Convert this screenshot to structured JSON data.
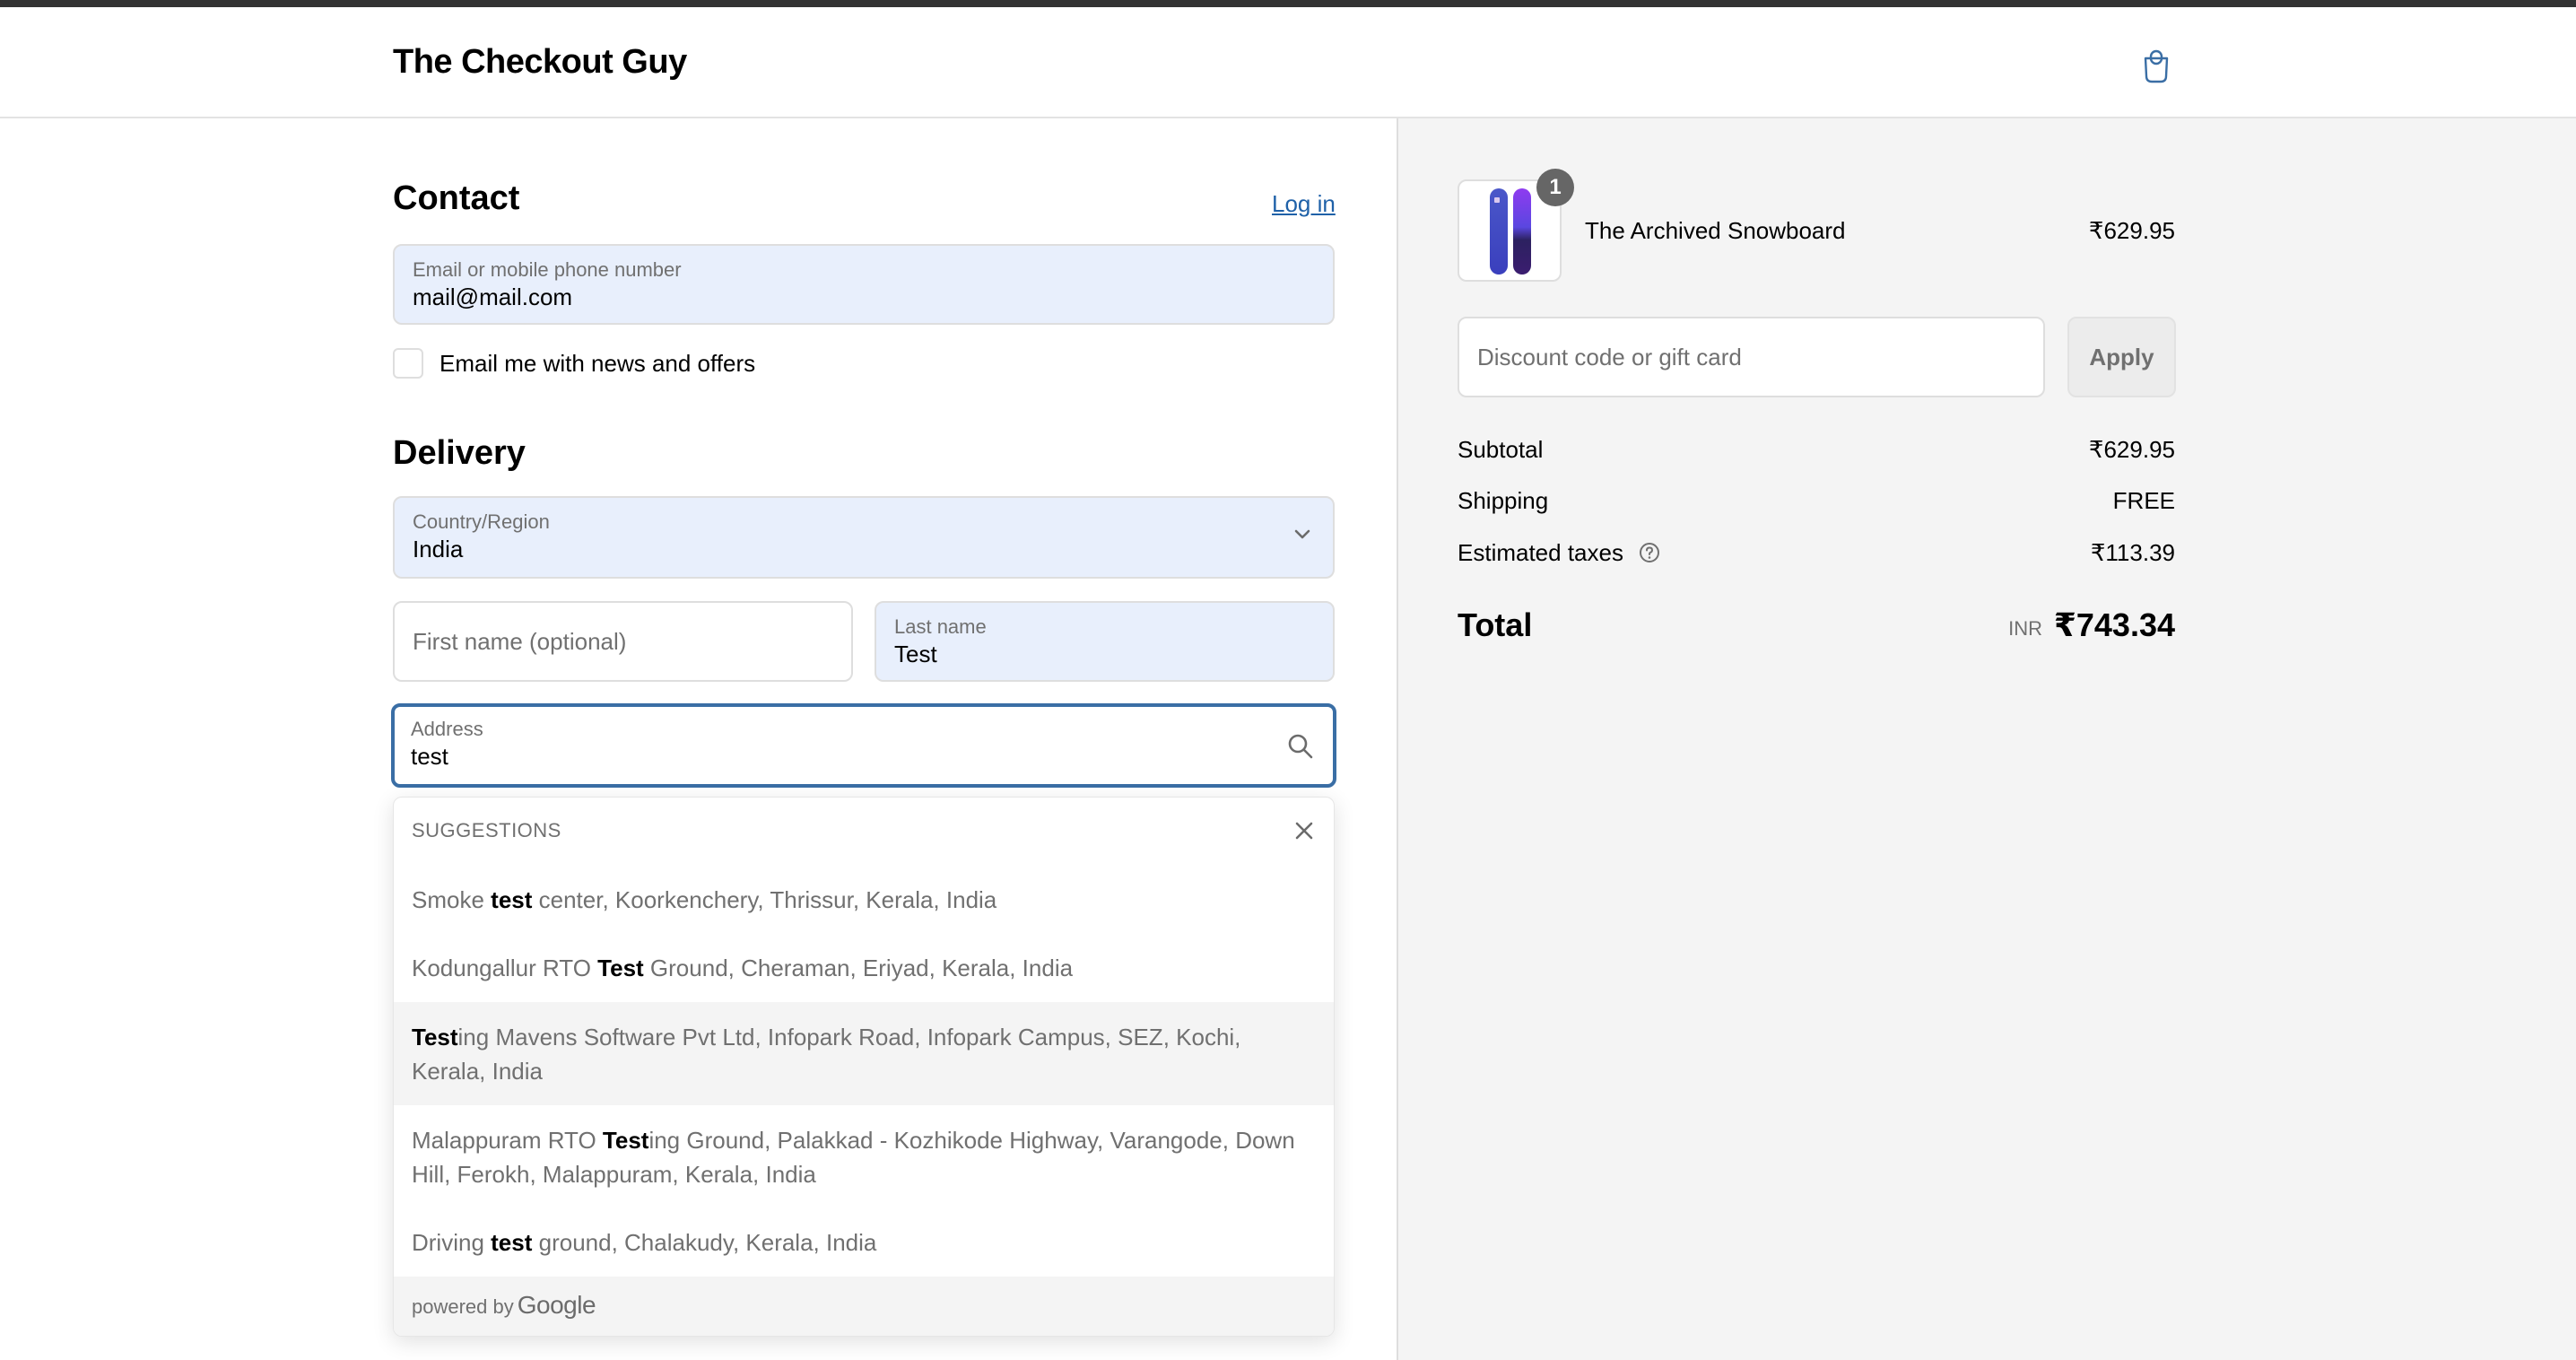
{
  "header": {
    "brand": "The Checkout Guy",
    "cart_icon": "shopping-bag-icon",
    "accent_color": "#3a6ea5"
  },
  "contact": {
    "title": "Contact",
    "login_link": "Log in",
    "email": {
      "label": "Email or mobile phone number",
      "value": "mail@mail.com"
    },
    "newsletter": {
      "label": "Email me with news and offers",
      "checked": false
    }
  },
  "delivery": {
    "title": "Delivery",
    "country": {
      "label": "Country/Region",
      "value": "India"
    },
    "first_name": {
      "placeholder": "First name (optional)",
      "value": ""
    },
    "last_name": {
      "label": "Last name",
      "value": "Test"
    },
    "address": {
      "label": "Address",
      "value": "test"
    }
  },
  "suggestions": {
    "title": "SUGGESTIONS",
    "items": [
      {
        "pre": "Smoke ",
        "match": "test",
        "post": " center, Koorkenchery, Thrissur, Kerala, India"
      },
      {
        "pre": "Kodungallur RTO ",
        "match": "Test",
        "post": " Ground, Cheraman, Eriyad, Kerala, India"
      },
      {
        "pre": "",
        "match": "Test",
        "post": "ing Mavens Software Pvt Ltd, Infopark Road, Infopark Campus, SEZ, Kochi, Kerala, India"
      },
      {
        "pre": "Malappuram RTO ",
        "match": "Test",
        "post": "ing Ground, Palakkad - Kozhikode Highway, Varangode, Down Hill, Ferokh, Malappuram, Kerala, India"
      },
      {
        "pre": "Driving ",
        "match": "test",
        "post": " ground, Chalakudy, Kerala, India"
      }
    ],
    "powered_by": "powered by",
    "provider": "Google"
  },
  "summary": {
    "product": {
      "name": "The Archived Snowboard",
      "price": "₹629.95",
      "quantity": "1"
    },
    "discount": {
      "placeholder": "Discount code or gift card",
      "apply_label": "Apply"
    },
    "subtotal": {
      "label": "Subtotal",
      "value": "₹629.95"
    },
    "shipping": {
      "label": "Shipping",
      "value": "FREE"
    },
    "taxes": {
      "label": "Estimated taxes",
      "value": "₹113.39"
    },
    "total": {
      "label": "Total",
      "currency": "INR",
      "value": "₹743.34"
    }
  }
}
